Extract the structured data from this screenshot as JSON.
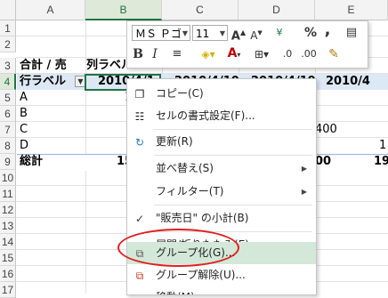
{
  "columns": [
    "A",
    "B",
    "C",
    "D",
    "E"
  ],
  "rows": [
    "1",
    "2",
    "3",
    "4",
    "5",
    "6",
    "7",
    "8",
    "9",
    "10",
    "11",
    "12",
    "13",
    "14",
    "15",
    "16",
    "17"
  ],
  "cells": {
    "a3": "合計 / 売",
    "b3": "列ラベル",
    "a4": "行ラベル",
    "b4": "2010/4/1",
    "c4": "2010/4/10",
    "d4": "2010/4/19",
    "e4": "2010/4",
    "a5": "A",
    "b5": "1",
    "a6": "B",
    "a7": "C",
    "d7": "400",
    "a8": "D",
    "e8": "1",
    "a9": "総計",
    "b9": "15",
    "d9": "00",
    "e9": "19"
  },
  "mini_toolbar": {
    "font_name": "ＭＳ Ｐゴ",
    "font_size": "11",
    "bold": "B",
    "italic": "I",
    "currency": "¥",
    "percent": "%",
    "comma": ","
  },
  "menu": {
    "items": [
      {
        "label": "コピー(C)",
        "icon": "copy-icon"
      },
      {
        "label": "セルの書式設定(F)...",
        "icon": "format-cells-icon"
      },
      {
        "label": "更新(R)",
        "icon": "refresh-icon"
      },
      {
        "label": "並べ替え(S)",
        "icon": "",
        "submenu": true
      },
      {
        "label": "フィルター(T)",
        "icon": "",
        "submenu": true
      },
      {
        "label": "\"販売日\" の小計(B)",
        "icon": "check-icon"
      },
      {
        "label": "展開/折りたたみ(E)",
        "icon": "",
        "submenu": true
      },
      {
        "label": "グループ化(G)...",
        "icon": "group-icon",
        "highlighted": true
      },
      {
        "label": "グループ解除(U)...",
        "icon": "ungroup-icon"
      },
      {
        "label": "移動(M)",
        "icon": ""
      }
    ]
  },
  "colors": {
    "accent": "#217346",
    "highlight": "#d3e8d8",
    "oval": "#e02020"
  }
}
